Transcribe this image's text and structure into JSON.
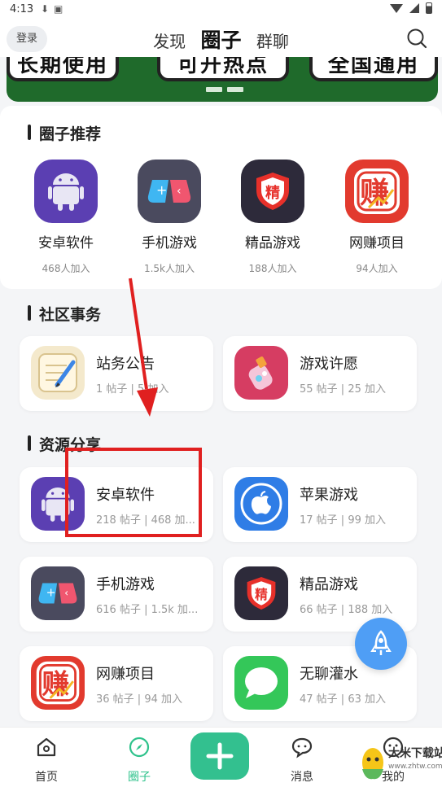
{
  "status_bar": {
    "time": "4:13"
  },
  "header": {
    "login_label": "登录",
    "tabs": [
      {
        "label": "发现"
      },
      {
        "label": "圈子"
      },
      {
        "label": "群聊"
      }
    ]
  },
  "banner": {
    "pills": [
      "长期使用",
      "可开热点",
      "全国通用"
    ]
  },
  "recommend": {
    "title": "圈子推荐",
    "items": [
      {
        "name": "安卓软件",
        "count": "468人加入",
        "icon": "android-icon",
        "color": "#5b3fb2"
      },
      {
        "name": "手机游戏",
        "count": "1.5k人加入",
        "icon": "gamepad-icon",
        "color": "#4a4a5e"
      },
      {
        "name": "精品游戏",
        "count": "188人加入",
        "icon": "shield-icon",
        "color": "#2d2a3a"
      },
      {
        "name": "网赚项目",
        "count": "94人加入",
        "icon": "earn-icon",
        "color": "#e23a2e"
      }
    ]
  },
  "community": {
    "title": "社区事务",
    "cards": [
      {
        "name": "站务公告",
        "meta": "1 帖子 | 5 加入",
        "icon": "notepad-icon"
      },
      {
        "name": "游戏许愿",
        "meta": "55 帖子 | 25 加入",
        "icon": "wish-bottle-icon"
      }
    ]
  },
  "resources": {
    "title": "资源分享",
    "cards": [
      {
        "name": "安卓软件",
        "meta": "218 帖子 | 468 加...",
        "icon": "android-icon"
      },
      {
        "name": "苹果游戏",
        "meta": "17 帖子 | 99 加入",
        "icon": "apple-icon"
      },
      {
        "name": "手机游戏",
        "meta": "616 帖子 | 1.5k 加...",
        "icon": "gamepad-icon"
      },
      {
        "name": "精品游戏",
        "meta": "66 帖子 | 188 加入",
        "icon": "shield-icon"
      },
      {
        "name": "网赚项目",
        "meta": "36 帖子 | 94 加入",
        "icon": "earn-icon"
      },
      {
        "name": "无聊灌水",
        "meta": "47 帖子 | 63 加入",
        "icon": "chat-bubble-icon"
      }
    ]
  },
  "bottom_nav": {
    "items": [
      {
        "label": "首页"
      },
      {
        "label": "圈子"
      },
      {
        "label": "消息"
      },
      {
        "label": "我的"
      }
    ]
  },
  "watermark": {
    "text": "大米下载站",
    "sub": "www.zhtw.com"
  },
  "colors": {
    "accent": "#33c08f",
    "annotation": "#e02020",
    "banner": "#1f6a2b"
  }
}
